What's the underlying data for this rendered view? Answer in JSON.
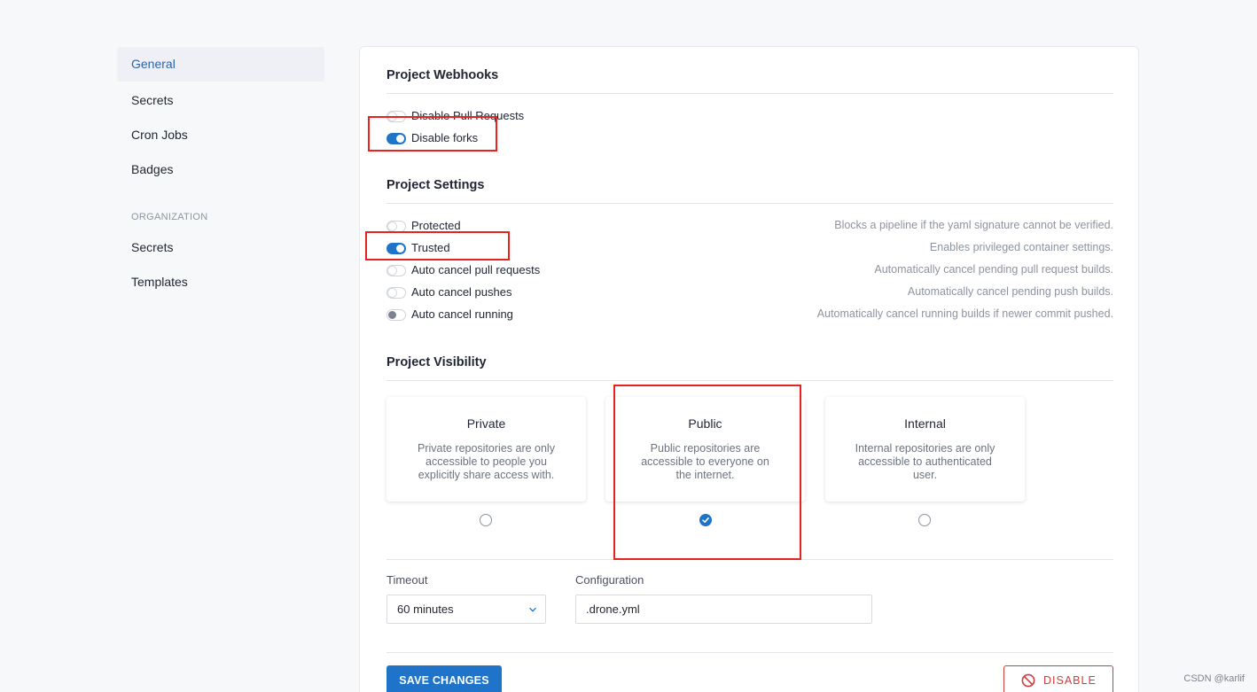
{
  "sidebar": {
    "items": [
      {
        "label": "General"
      },
      {
        "label": "Secrets"
      },
      {
        "label": "Cron Jobs"
      },
      {
        "label": "Badges"
      }
    ],
    "org_heading": "ORGANIZATION",
    "org_items": [
      {
        "label": "Secrets"
      },
      {
        "label": "Templates"
      }
    ]
  },
  "webhooks": {
    "title": "Project Webhooks",
    "toggles": [
      {
        "label": "Disable Pull Requests",
        "on": false
      },
      {
        "label": "Disable forks",
        "on": true
      }
    ]
  },
  "settings": {
    "title": "Project Settings",
    "toggles": [
      {
        "label": "Protected",
        "desc": "Blocks a pipeline if the yaml signature cannot be verified.",
        "on": false
      },
      {
        "label": "Trusted",
        "desc": "Enables privileged container settings.",
        "on": true
      },
      {
        "label": "Auto cancel pull requests",
        "desc": "Automatically cancel pending pull request builds.",
        "on": false
      },
      {
        "label": "Auto cancel pushes",
        "desc": "Automatically cancel pending push builds.",
        "on": false
      },
      {
        "label": "Auto cancel running",
        "desc": "Automatically cancel running builds if newer commit pushed.",
        "on": false
      }
    ]
  },
  "visibility": {
    "title": "Project Visibility",
    "options": [
      {
        "title": "Private",
        "desc": "Private repositories are only accessible to people you explicitly share access with.",
        "selected": false
      },
      {
        "title": "Public",
        "desc": "Public repositories are accessible to everyone on the internet.",
        "selected": true
      },
      {
        "title": "Internal",
        "desc": "Internal repositories are only accessible to authenticated user.",
        "selected": false
      }
    ]
  },
  "timeout": {
    "label": "Timeout",
    "value": "60 minutes"
  },
  "configuration": {
    "label": "Configuration",
    "value": ".drone.yml"
  },
  "actions": {
    "save": "SAVE CHANGES",
    "disable": "DISABLE"
  },
  "watermark": "CSDN @karlif",
  "colors": {
    "accent": "#1f74c9",
    "danger": "#d33a3a",
    "annotation": "#e8231f"
  }
}
